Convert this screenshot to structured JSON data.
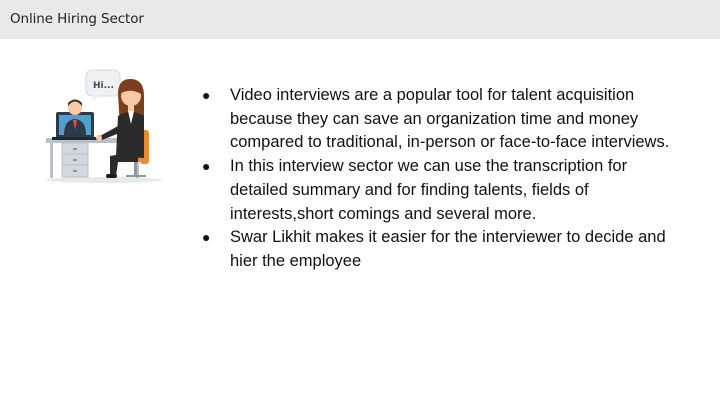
{
  "header": {
    "title": "Online Hiring Sector"
  },
  "illustration": {
    "speech_bubble_text": "Hi...",
    "colors": {
      "desk": "#b9c1c6",
      "laptop": "#2d3b49",
      "chair": "#e98a2e",
      "jacket": "#2b2b2b",
      "hair": "#7a3f1e",
      "skin": "#f7c9a6"
    }
  },
  "main": {
    "bullets": [
      "Video interviews are a popular tool for talent acquisition because they can save an organization time and money compared to traditional, in-person or face-to-face interviews.",
      "In this interview sector we can use the transcription for detailed summary and for finding talents, fields of interests,short comings and several more.",
      "Swar Likhit makes it easier for the interviewer to decide and hier the employee"
    ]
  }
}
